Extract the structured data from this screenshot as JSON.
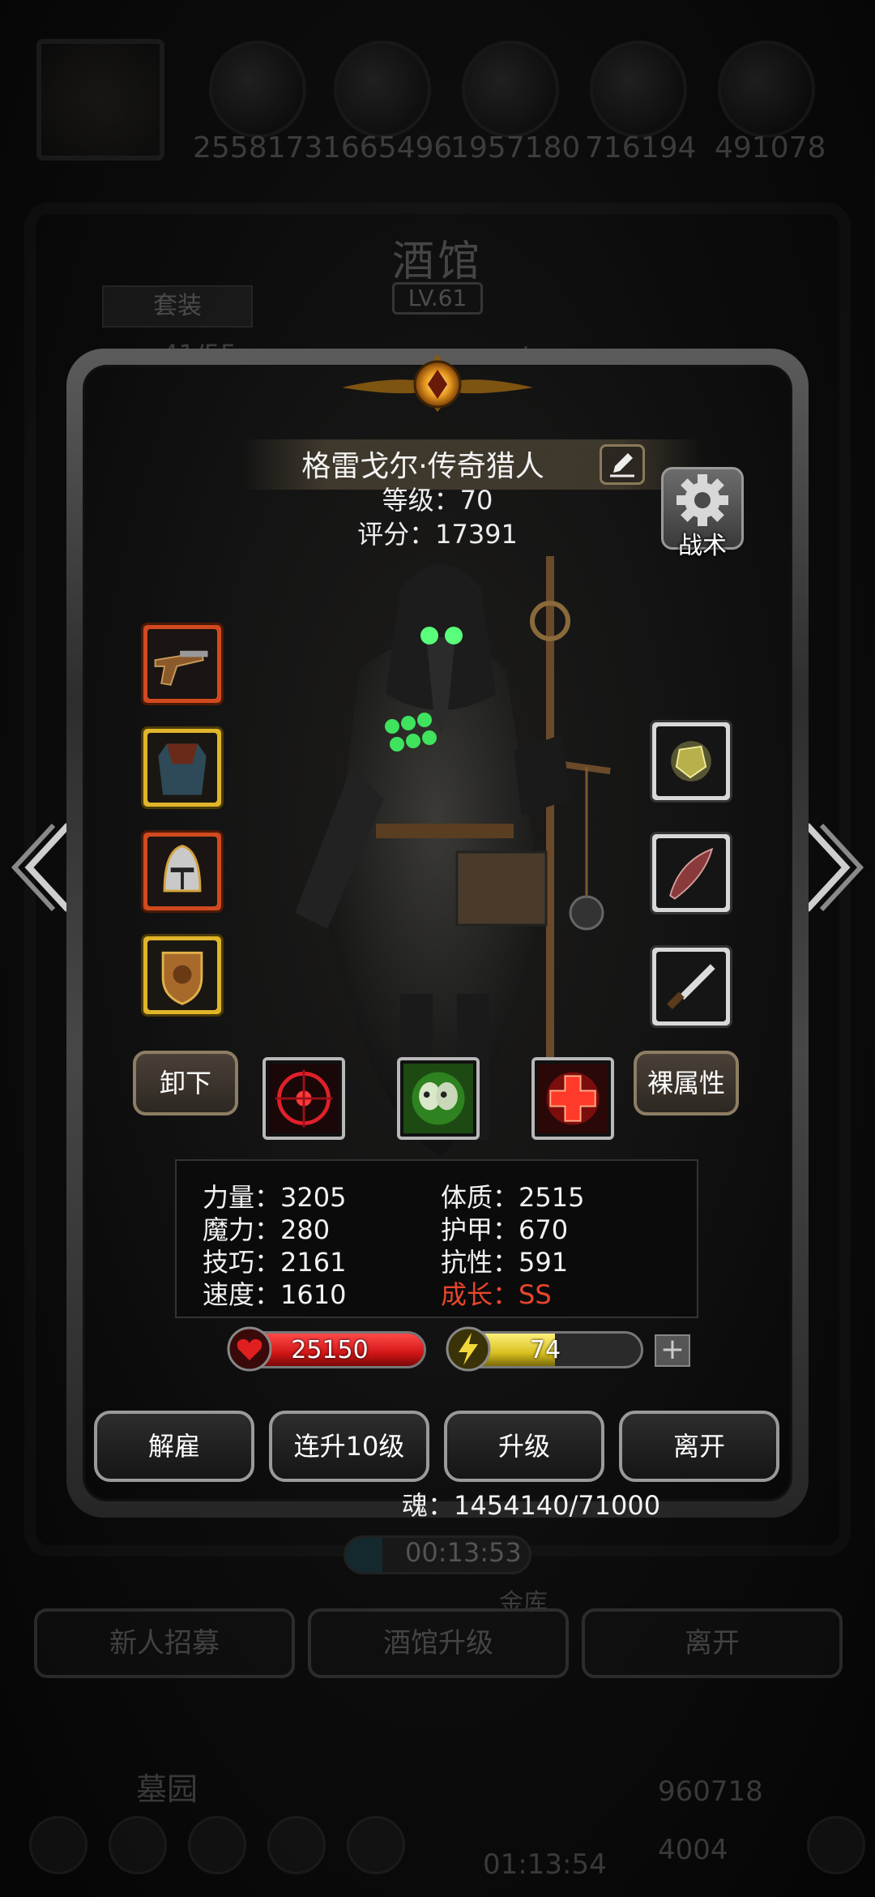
{
  "background": {
    "resources": [
      "2558173",
      "1665496",
      "1957180",
      "716194",
      "491078"
    ],
    "title": "酒馆",
    "level": "LV.61",
    "tab_suit": "套装",
    "count_text": "41/55",
    "soul_partial": "魂：1454140",
    "timer": "00:13:53",
    "floor_text": "金库",
    "buttons": [
      "新人招募",
      "酒馆升级",
      "离开"
    ],
    "garden": "墓园",
    "gold": "960718",
    "gem": "4004",
    "dock_timer": "01:13:54"
  },
  "hero": {
    "name": "格雷戈尔·传奇猎人",
    "level_text": "等级：70",
    "score_text": "评分：17391",
    "tactics_label": "战术"
  },
  "slots": {
    "left": [
      "flintlock-pistol",
      "cloak-armor",
      "knight-helmet",
      "lion-shield"
    ],
    "right": [
      "yellow-gem",
      "red-feather",
      "dagger"
    ]
  },
  "skills": [
    "red-target-skill",
    "green-skull-skill",
    "red-cross-skill"
  ],
  "buttons": {
    "unequip": "卸下",
    "base_attr": "裸属性",
    "dismiss": "解雇",
    "level_up_10": "连升10级",
    "level_up": "升级",
    "leave": "离开"
  },
  "stats": {
    "strength": "力量：3205",
    "constitution": "体质：2515",
    "magic": "魔力：280",
    "armor": "护甲：670",
    "skill": "技巧：2161",
    "resistance": "抗性：591",
    "speed": "速度：1610",
    "growth": "成长：SS"
  },
  "bars": {
    "hp": "25150",
    "hp_fill": 1.0,
    "energy": "74",
    "energy_fill": 0.55,
    "plus": "+"
  },
  "soul": "魂：1454140/71000",
  "colors": {
    "hp": "#d21616",
    "energy": "#d8c020",
    "growth": "#e8452c"
  }
}
